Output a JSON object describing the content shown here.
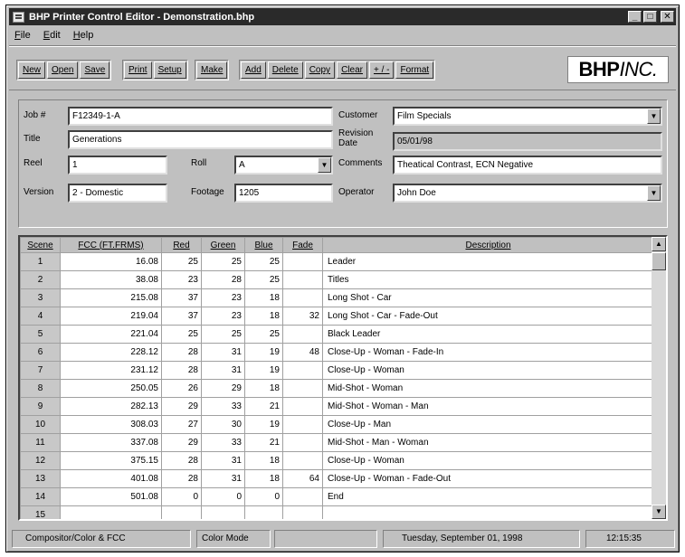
{
  "window": {
    "title": "BHP Printer Control Editor - Demonstration.bhp"
  },
  "menu": [
    "File",
    "Edit",
    "Help"
  ],
  "toolbar": {
    "group1": [
      "New",
      "Open",
      "Save"
    ],
    "group2": [
      "Print",
      "Setup"
    ],
    "group3": [
      "Make"
    ],
    "group4": [
      "Add",
      "Delete",
      "Copy",
      "Clear",
      "+ / -",
      "Format"
    ],
    "brand_bold": "BHP",
    "brand_italic": "INC."
  },
  "form": {
    "job_label": "Job #",
    "job_value": "F12349-1-A",
    "customer_label": "Customer",
    "customer_value": "Film Specials",
    "title_label": "Title",
    "title_value": "Generations",
    "revision_label": "Revision Date",
    "revision_value": "05/01/98",
    "reel_label": "Reel",
    "reel_value": "1",
    "roll_label": "Roll",
    "roll_value": "A",
    "comments_label": "Comments",
    "comments_value": "Theatical Contrast, ECN Negative",
    "version_label": "Version",
    "version_value": "2 - Domestic",
    "footage_label": "Footage",
    "footage_value": "1205",
    "operator_label": "Operator",
    "operator_value": "John Doe"
  },
  "grid": {
    "headers": [
      "Scene",
      "FCC (FT.FRMS)",
      "Red",
      "Green",
      "Blue",
      "Fade",
      "Description"
    ],
    "rows": [
      [
        "1",
        "16.08",
        "25",
        "25",
        "25",
        "",
        "Leader"
      ],
      [
        "2",
        "38.08",
        "23",
        "28",
        "25",
        "",
        "Titles"
      ],
      [
        "3",
        "215.08",
        "37",
        "23",
        "18",
        "",
        "Long Shot - Car"
      ],
      [
        "4",
        "219.04",
        "37",
        "23",
        "18",
        "32",
        "Long Shot - Car - Fade-Out"
      ],
      [
        "5",
        "221.04",
        "25",
        "25",
        "25",
        "",
        "Black Leader"
      ],
      [
        "6",
        "228.12",
        "28",
        "31",
        "19",
        "48",
        "Close-Up - Woman - Fade-In"
      ],
      [
        "7",
        "231.12",
        "28",
        "31",
        "19",
        "",
        "Close-Up - Woman"
      ],
      [
        "8",
        "250.05",
        "26",
        "29",
        "18",
        "",
        "Mid-Shot - Woman"
      ],
      [
        "9",
        "282.13",
        "29",
        "33",
        "21",
        "",
        "Mid-Shot - Woman - Man"
      ],
      [
        "10",
        "308.03",
        "27",
        "30",
        "19",
        "",
        "Close-Up - Man"
      ],
      [
        "11",
        "337.08",
        "29",
        "33",
        "21",
        "",
        "Mid-Shot - Man - Woman"
      ],
      [
        "12",
        "375.15",
        "28",
        "31",
        "18",
        "",
        "Close-Up - Woman"
      ],
      [
        "13",
        "401.08",
        "28",
        "31",
        "18",
        "64",
        "Close-Up - Woman - Fade-Out"
      ],
      [
        "14",
        "501.08",
        "0",
        "0",
        "0",
        "",
        "End"
      ],
      [
        "15",
        "",
        "",
        "",
        "",
        "",
        ""
      ]
    ]
  },
  "status": {
    "mode": "Compositor/Color & FCC",
    "color_mode": "Color Mode",
    "empty": "",
    "date": "Tuesday, September 01, 1998",
    "time": "12:15:35"
  }
}
